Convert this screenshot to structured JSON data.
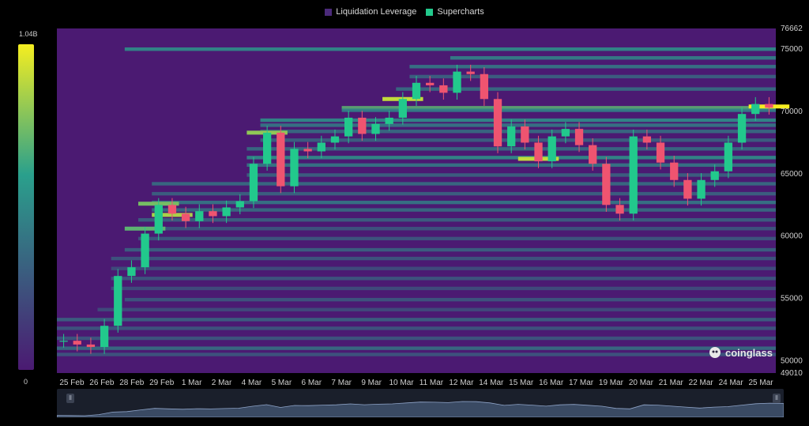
{
  "legend": {
    "items": [
      {
        "label": "Liquidation Leverage",
        "color": "#4b2a7a"
      },
      {
        "label": "Supercharts",
        "color": "#22c98c"
      }
    ]
  },
  "colorbar": {
    "max_label": "1.04B",
    "min_label": "0"
  },
  "watermark": {
    "text": "coinglass"
  },
  "navigator": {
    "left_handle": "ll",
    "right_handle": "ll"
  },
  "colors": {
    "background": "#000000",
    "heat_low": "#4b1a72",
    "heat_mid": "#2aa08c",
    "heat_high": "#f5ee20",
    "candle_up": "#22c98c",
    "candle_down": "#ef5470"
  },
  "chart_data": {
    "type": "heatmap",
    "title": "",
    "xlabel": "",
    "ylabel": "",
    "x_labels": [
      "25 Feb",
      "26 Feb",
      "28 Feb",
      "29 Feb",
      "1 Mar",
      "2 Mar",
      "4 Mar",
      "5 Mar",
      "6 Mar",
      "7 Mar",
      "9 Mar",
      "10 Mar",
      "11 Mar",
      "12 Mar",
      "14 Mar",
      "15 Mar",
      "16 Mar",
      "17 Mar",
      "19 Mar",
      "20 Mar",
      "21 Mar",
      "22 Mar",
      "24 Mar",
      "25 Mar"
    ],
    "y_tick_labels": [
      "49010",
      "50000",
      "55000",
      "60000",
      "65000",
      "70000",
      "75000",
      "76662"
    ],
    "ylim": [
      49010,
      76662
    ],
    "colorbar_range": [
      "0",
      "1.04B"
    ],
    "price_series": {
      "name": "",
      "values": [
        51600,
        51300,
        51100,
        52800,
        56800,
        57500,
        60200,
        62500,
        61800,
        61200,
        62000,
        61600,
        62300,
        62800,
        65800,
        68300,
        64000,
        67000,
        66800,
        67500,
        68000,
        69500,
        68200,
        69000,
        69500,
        71000,
        72300,
        72100,
        71500,
        73200,
        73000,
        71000,
        67200,
        68800,
        67500,
        66000,
        68000,
        68600,
        67300,
        65800,
        62500,
        61800,
        68000,
        67500,
        65900,
        64500,
        63000,
        64500,
        65200,
        67500,
        69800,
        70600,
        70300
      ]
    },
    "liquidation_levels": [
      {
        "price": 75000,
        "intensity": 0.55
      },
      {
        "price": 74300,
        "intensity": 0.5
      },
      {
        "price": 73600,
        "intensity": 0.45
      },
      {
        "price": 72800,
        "intensity": 0.35
      },
      {
        "price": 71800,
        "intensity": 0.4
      },
      {
        "price": 70300,
        "intensity": 0.7
      },
      {
        "price": 70100,
        "intensity": 0.5
      },
      {
        "price": 69300,
        "intensity": 0.55
      },
      {
        "price": 68900,
        "intensity": 0.45
      },
      {
        "price": 68400,
        "intensity": 0.4
      },
      {
        "price": 67700,
        "intensity": 0.35
      },
      {
        "price": 67000,
        "intensity": 0.4
      },
      {
        "price": 66300,
        "intensity": 0.55
      },
      {
        "price": 65700,
        "intensity": 0.45
      },
      {
        "price": 64900,
        "intensity": 0.35
      },
      {
        "price": 64200,
        "intensity": 0.4
      },
      {
        "price": 63400,
        "intensity": 0.35
      },
      {
        "price": 62700,
        "intensity": 0.45
      },
      {
        "price": 62100,
        "intensity": 0.4
      },
      {
        "price": 61300,
        "intensity": 0.35
      },
      {
        "price": 60600,
        "intensity": 0.3
      },
      {
        "price": 59800,
        "intensity": 0.3
      },
      {
        "price": 58900,
        "intensity": 0.35
      },
      {
        "price": 58200,
        "intensity": 0.3
      },
      {
        "price": 57400,
        "intensity": 0.25
      },
      {
        "price": 56600,
        "intensity": 0.3
      },
      {
        "price": 55800,
        "intensity": 0.25
      },
      {
        "price": 54900,
        "intensity": 0.3
      },
      {
        "price": 54100,
        "intensity": 0.25
      },
      {
        "price": 53300,
        "intensity": 0.35
      },
      {
        "price": 52600,
        "intensity": 0.3
      },
      {
        "price": 51800,
        "intensity": 0.3
      },
      {
        "price": 51000,
        "intensity": 0.4
      },
      {
        "price": 50500,
        "intensity": 0.3
      }
    ],
    "hot_spots": [
      {
        "price": 70400,
        "intensity": 1.0
      },
      {
        "price": 71000,
        "intensity": 0.9
      },
      {
        "price": 66200,
        "intensity": 0.9
      },
      {
        "price": 61700,
        "intensity": 0.85
      },
      {
        "price": 68300,
        "intensity": 0.8
      },
      {
        "price": 62600,
        "intensity": 0.75
      },
      {
        "price": 60600,
        "intensity": 0.7
      }
    ]
  }
}
